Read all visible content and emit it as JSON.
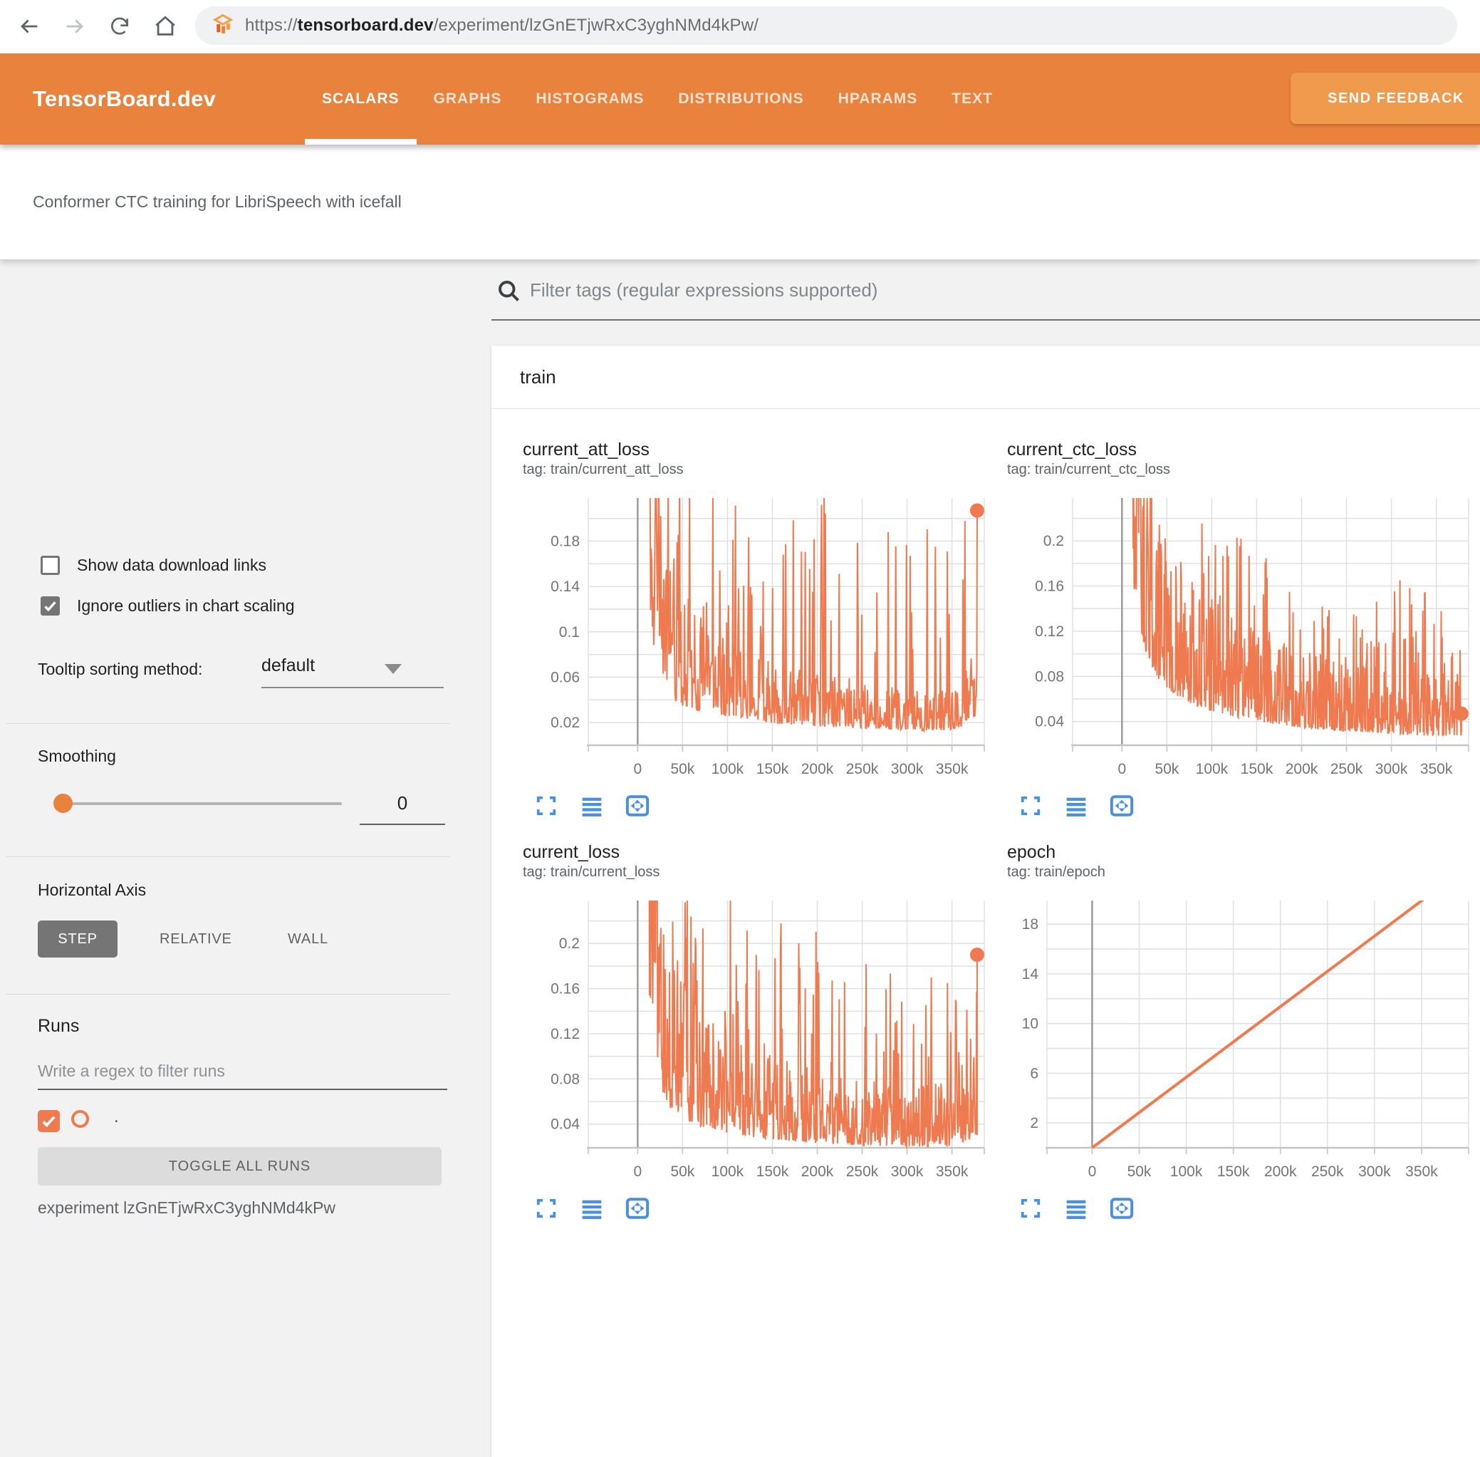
{
  "browser": {
    "url_prefix": "https://",
    "url_domain": "tensorboard.dev",
    "url_path": "/experiment/lzGnETjwRxC3yghNMd4kPw/"
  },
  "header": {
    "logo": "TensorBoard.dev",
    "tabs": [
      {
        "label": "SCALARS",
        "active": true
      },
      {
        "label": "GRAPHS",
        "active": false
      },
      {
        "label": "HISTOGRAMS",
        "active": false
      },
      {
        "label": "DISTRIBUTIONS",
        "active": false
      },
      {
        "label": "HPARAMS",
        "active": false
      },
      {
        "label": "TEXT",
        "active": false
      }
    ],
    "feedback_label": "SEND FEEDBACK"
  },
  "subtitle": "Conformer CTC training for LibriSpeech with icefall",
  "sidebar": {
    "show_links_label": "Show data download links",
    "show_links_checked": false,
    "ignore_outliers_label": "Ignore outliers in chart scaling",
    "ignore_outliers_checked": true,
    "tooltip_label": "Tooltip sorting method:",
    "tooltip_value": "default",
    "smoothing_label": "Smoothing",
    "smoothing_value": "0",
    "axis_label": "Horizontal Axis",
    "axis_options": [
      "STEP",
      "RELATIVE",
      "WALL"
    ],
    "axis_selected": "STEP",
    "runs_label": "Runs",
    "runs_placeholder": "Write a regex to filter runs",
    "run_name": ".",
    "run_checked": true,
    "toggle_button": "TOGGLE ALL RUNS",
    "experiment_text": "experiment lzGnETjwRxC3yghNMd4kPw"
  },
  "main": {
    "filter_placeholder": "Filter tags (regular expressions supported)",
    "section_label": "train"
  },
  "colors": {
    "header_orange": "#e8823c",
    "feedback_orange": "#f09a4e",
    "run_color": "#ef7a4f",
    "toolbar_blue": "#4a90e2",
    "grid_line": "#dedede",
    "axis_line": "#c4c4c4",
    "zero_line": "#9b9b9b",
    "tick_text": "#757575"
  },
  "chart_data": [
    {
      "type": "line",
      "title": "current_att_loss",
      "tag": "tag: train/current_att_loss",
      "x_tick_values": [
        0,
        50000,
        100000,
        150000,
        200000,
        250000,
        300000,
        350000
      ],
      "x_tick_labels": [
        "0",
        "50k",
        "100k",
        "150k",
        "200k",
        "250k",
        "300k",
        "350k"
      ],
      "xlim": [
        -55000,
        386000
      ],
      "ylim": [
        0,
        0.218
      ],
      "y_grid_start": 0.02,
      "y_grid_step": 0.02,
      "y_label_values": [
        0.02,
        0.06,
        0.1,
        0.14,
        0.18
      ],
      "y_label_texts": [
        "0.02",
        "0.06",
        "0.1",
        "0.14",
        "0.18"
      ],
      "grid_left": 92,
      "series": {
        "name": ".",
        "style": "noisy",
        "seed": 11,
        "dt": 700,
        "start": 13000,
        "end": 378000,
        "baseline": [
          [
            13000,
            0.26
          ],
          [
            20000,
            0.13
          ],
          [
            30000,
            0.095
          ],
          [
            45000,
            0.072
          ],
          [
            60000,
            0.063
          ],
          [
            80000,
            0.057
          ],
          [
            100000,
            0.052
          ],
          [
            130000,
            0.044
          ],
          [
            160000,
            0.037
          ],
          [
            200000,
            0.033
          ],
          [
            240000,
            0.031
          ],
          [
            280000,
            0.028
          ],
          [
            320000,
            0.026
          ],
          [
            360000,
            0.028
          ],
          [
            378000,
            0.05
          ]
        ],
        "spike_max": [
          [
            13000,
            0.27
          ],
          [
            40000,
            0.25
          ],
          [
            80000,
            0.23
          ],
          [
            150000,
            0.22
          ],
          [
            200000,
            0.23
          ],
          [
            250000,
            0.2
          ],
          [
            300000,
            0.19
          ],
          [
            350000,
            0.21
          ],
          [
            378000,
            0.21
          ]
        ],
        "spike_prob": 0.12,
        "jitter_base": 0.5,
        "jitter_amp": 1.4,
        "endpoint": [
          378000,
          0.207
        ],
        "endpoint_dot": true
      }
    },
    {
      "type": "line",
      "title": "current_ctc_loss",
      "tag": "tag: train/current_ctc_loss",
      "x_tick_values": [
        0,
        50000,
        100000,
        150000,
        200000,
        250000,
        300000,
        350000
      ],
      "x_tick_labels": [
        "0",
        "50k",
        "100k",
        "150k",
        "200k",
        "250k",
        "300k",
        "350k"
      ],
      "xlim": [
        -55000,
        386000
      ],
      "ylim": [
        0.019,
        0.238
      ],
      "y_grid_start": 0.04,
      "y_grid_step": 0.02,
      "y_label_values": [
        0.04,
        0.08,
        0.12,
        0.16,
        0.2
      ],
      "y_label_texts": [
        "0.04",
        "0.08",
        "0.12",
        "0.16",
        "0.2"
      ],
      "grid_left": 92,
      "series": {
        "name": ".",
        "style": "noisy",
        "seed": 23,
        "dt": 500,
        "start": 12000,
        "end": 378000,
        "baseline": [
          [
            12000,
            0.3
          ],
          [
            25000,
            0.19
          ],
          [
            40000,
            0.14
          ],
          [
            60000,
            0.115
          ],
          [
            80000,
            0.1
          ],
          [
            100000,
            0.09
          ],
          [
            130000,
            0.079
          ],
          [
            160000,
            0.071
          ],
          [
            200000,
            0.063
          ],
          [
            240000,
            0.058
          ],
          [
            280000,
            0.055
          ],
          [
            320000,
            0.051
          ],
          [
            360000,
            0.049
          ],
          [
            378000,
            0.05
          ]
        ],
        "spike_max": [
          [
            12000,
            0.3
          ],
          [
            50000,
            0.26
          ],
          [
            100000,
            0.21
          ],
          [
            150000,
            0.2
          ],
          [
            200000,
            0.15
          ],
          [
            250000,
            0.14
          ],
          [
            300000,
            0.17
          ],
          [
            350000,
            0.15
          ],
          [
            378000,
            0.12
          ]
        ],
        "spike_prob": 0.1,
        "jitter_base": 0.55,
        "jitter_amp": 1.1,
        "endpoint": [
          378000,
          0.047
        ],
        "endpoint_dot": true
      }
    },
    {
      "type": "line",
      "title": "current_loss",
      "tag": "tag: train/current_loss",
      "x_tick_values": [
        0,
        50000,
        100000,
        150000,
        200000,
        250000,
        300000,
        350000
      ],
      "x_tick_labels": [
        "0",
        "50k",
        "100k",
        "150k",
        "200k",
        "250k",
        "300k",
        "350k"
      ],
      "xlim": [
        -55000,
        386000
      ],
      "ylim": [
        0.019,
        0.238
      ],
      "y_grid_start": 0.04,
      "y_grid_step": 0.02,
      "y_label_values": [
        0.04,
        0.08,
        0.12,
        0.16,
        0.2
      ],
      "y_label_texts": [
        "0.04",
        "0.08",
        "0.12",
        "0.16",
        "0.2"
      ],
      "grid_left": 92,
      "series": {
        "name": ".",
        "style": "noisy",
        "seed": 37,
        "dt": 600,
        "start": 12000,
        "end": 378000,
        "baseline": [
          [
            12000,
            0.3
          ],
          [
            22000,
            0.16
          ],
          [
            35000,
            0.11
          ],
          [
            55000,
            0.086
          ],
          [
            80000,
            0.071
          ],
          [
            110000,
            0.061
          ],
          [
            150000,
            0.053
          ],
          [
            200000,
            0.046
          ],
          [
            250000,
            0.042
          ],
          [
            300000,
            0.04
          ],
          [
            350000,
            0.04
          ],
          [
            378000,
            0.06
          ]
        ],
        "spike_max": [
          [
            12000,
            0.3
          ],
          [
            60000,
            0.26
          ],
          [
            120000,
            0.24
          ],
          [
            180000,
            0.22
          ],
          [
            240000,
            0.2
          ],
          [
            300000,
            0.19
          ],
          [
            350000,
            0.18
          ],
          [
            378000,
            0.19
          ]
        ],
        "spike_prob": 0.12,
        "jitter_base": 0.5,
        "jitter_amp": 1.4,
        "endpoint": [
          378000,
          0.19
        ],
        "endpoint_dot": true
      }
    },
    {
      "type": "line",
      "title": "epoch",
      "tag": "tag: train/epoch",
      "x_tick_values": [
        0,
        50000,
        100000,
        150000,
        200000,
        250000,
        300000,
        350000
      ],
      "x_tick_labels": [
        "0",
        "50k",
        "100k",
        "150k",
        "200k",
        "250k",
        "300k",
        "350k"
      ],
      "xlim": [
        -48000,
        400000
      ],
      "ylim": [
        0,
        19.9
      ],
      "y_grid_start": 2,
      "y_grid_step": 2,
      "y_label_values": [
        2,
        6,
        10,
        14,
        18
      ],
      "y_label_texts": [
        "2",
        "6",
        "10",
        "14",
        "18"
      ],
      "grid_left": 56,
      "series": {
        "name": ".",
        "style": "linear",
        "points": [
          [
            0,
            0
          ],
          [
            352000,
            20
          ]
        ],
        "endpoint_dot": false
      }
    }
  ]
}
